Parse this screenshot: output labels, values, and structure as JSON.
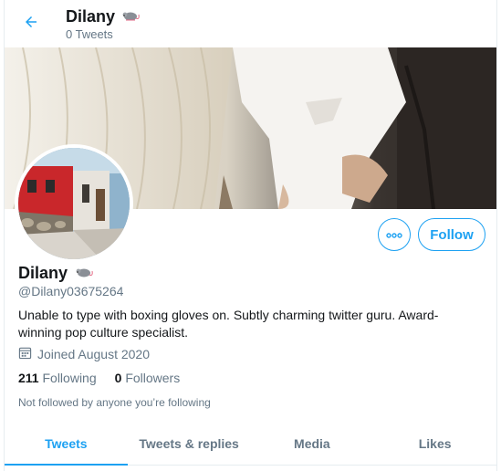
{
  "header": {
    "name": "Dilany",
    "tweet_count": "0 Tweets",
    "back_icon": "arrow-left-icon",
    "emoji_icon": "rat-icon"
  },
  "profile": {
    "name": "Dilany",
    "handle": "@Dilany03675264",
    "bio": "Unable to type with boxing gloves on. Subtly charming twitter guru. Award-winning pop culture specialist.",
    "joined": "Joined August 2020",
    "following_count": "211",
    "following_label": "Following",
    "followers_count": "0",
    "followers_label": "Followers",
    "not_followed": "Not followed by anyone you’re following"
  },
  "actions": {
    "more_icon": "ellipsis-icon",
    "follow_label": "Follow"
  },
  "tabs": [
    {
      "label": "Tweets",
      "active": true
    },
    {
      "label": "Tweets & replies",
      "active": false
    },
    {
      "label": "Media",
      "active": false
    },
    {
      "label": "Likes",
      "active": false
    }
  ],
  "colors": {
    "accent": "#1da1f2",
    "secondary_text": "#657786",
    "primary_text": "#14171a"
  }
}
